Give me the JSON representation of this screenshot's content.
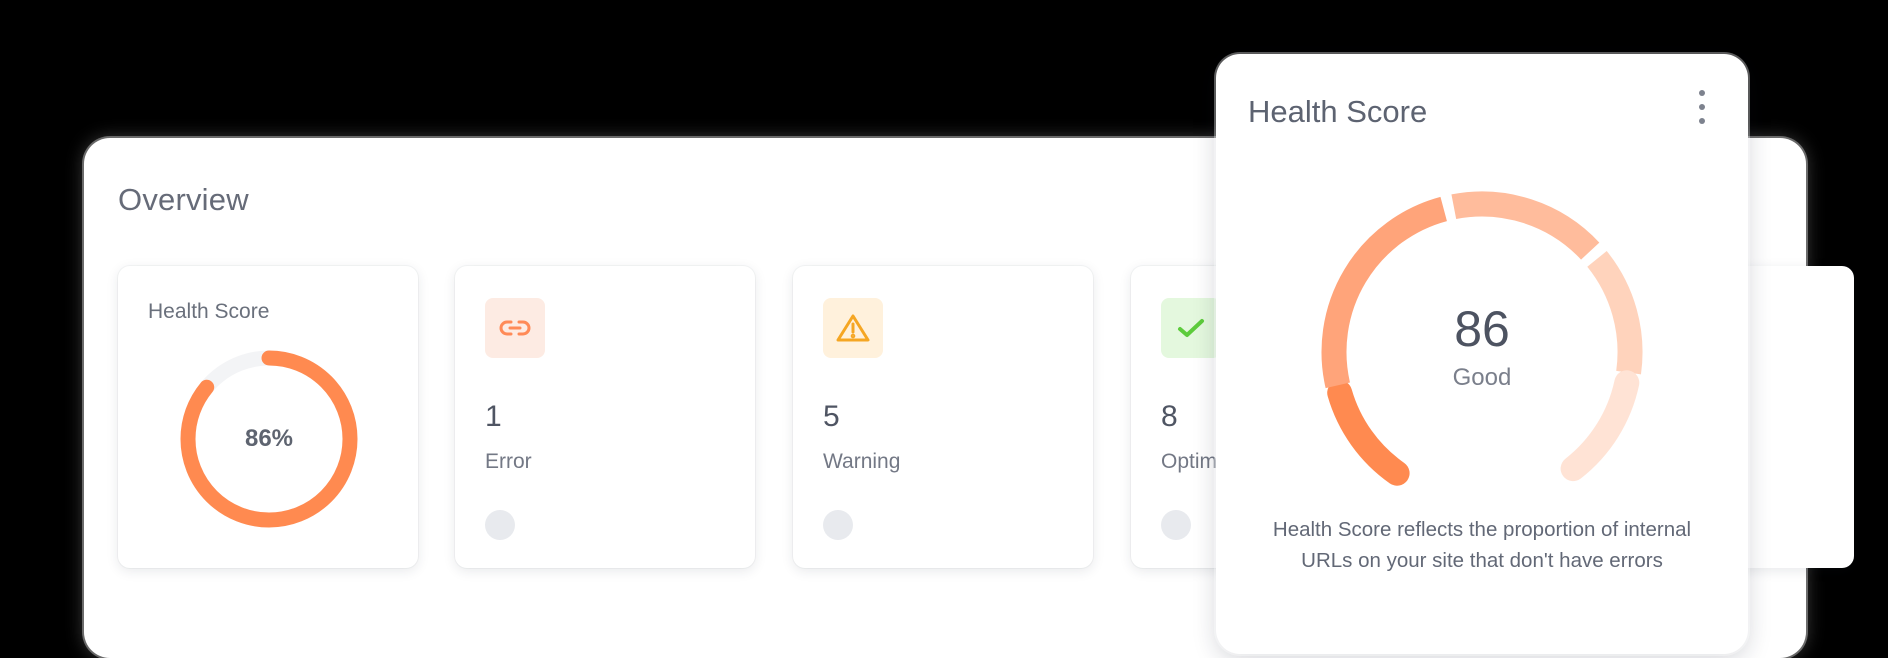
{
  "overview": {
    "title": "Overview",
    "health_card": {
      "title": "Health Score",
      "percent_label": "86%",
      "percent": 86
    },
    "cards": [
      {
        "icon": "link-icon",
        "count": "1",
        "label": "Error",
        "accent": "#fdebe3",
        "icon_color": "#ff8a57"
      },
      {
        "icon": "warning-icon",
        "count": "5",
        "label": "Warning",
        "accent": "#fff1dc",
        "icon_color": "#f5a623"
      },
      {
        "icon": "check-icon",
        "count": "8",
        "label": "Optim",
        "accent": "#e4f8de",
        "icon_color": "#5dcc3c"
      }
    ]
  },
  "popup": {
    "title": "Health Score",
    "score": "86",
    "rating": "Good",
    "description_line1": "Health Score reflects the proportion of internal",
    "description_line2": "URLs on your site that don't have errors"
  },
  "colors": {
    "accent_orange": "#ff8a50",
    "donut_track": "#f3f4f6",
    "gauge_segments": [
      "#ff8a50",
      "#ffa47a",
      "#ffbc9c",
      "#ffd3bc",
      "#ffe3d5"
    ]
  }
}
